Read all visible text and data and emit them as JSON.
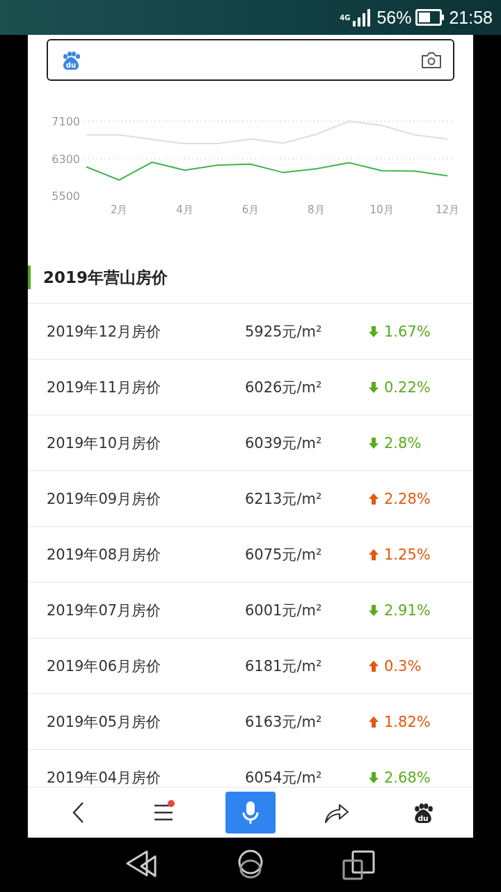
{
  "status_bar": {
    "network": "4G",
    "battery": "56%",
    "time": "21:58"
  },
  "search": {
    "logo_text": "du"
  },
  "chart": {
    "chart_data": {
      "type": "line",
      "x": [
        1,
        2,
        3,
        4,
        5,
        6,
        7,
        8,
        9,
        10,
        11,
        12
      ],
      "xlim": [
        1,
        12
      ],
      "xticks": [
        {
          "value": 2,
          "label": "2月"
        },
        {
          "value": 4,
          "label": "4月"
        },
        {
          "value": 6,
          "label": "6月"
        },
        {
          "value": 8,
          "label": "8月"
        },
        {
          "value": 10,
          "label": "10月"
        },
        {
          "value": 12,
          "label": "12月"
        }
      ],
      "ylim": [
        5500,
        7100
      ],
      "yticks": [
        5500,
        6300,
        7100
      ],
      "series": [
        {
          "color": "#dddddd",
          "values": [
            6810,
            6810,
            6710,
            6620,
            6620,
            6720,
            6630,
            6820,
            7100,
            7010,
            6810,
            6720
          ]
        },
        {
          "color": "#3cb44b",
          "values": [
            6120,
            5840,
            6220,
            6050,
            6160,
            6180,
            6000,
            6080,
            6210,
            6040,
            6030,
            5930
          ]
        }
      ]
    }
  },
  "section_title": "2019年营山房价",
  "rows": [
    {
      "month": "2019年12月房价",
      "price": "5925元/m²",
      "kind": "down",
      "change": "1.67%"
    },
    {
      "month": "2019年11月房价",
      "price": "6026元/m²",
      "kind": "down",
      "change": "0.22%"
    },
    {
      "month": "2019年10月房价",
      "price": "6039元/m²",
      "kind": "down",
      "change": "2.8%"
    },
    {
      "month": "2019年09月房价",
      "price": "6213元/m²",
      "kind": "up",
      "change": "2.28%"
    },
    {
      "month": "2019年08月房价",
      "price": "6075元/m²",
      "kind": "up",
      "change": "1.25%"
    },
    {
      "month": "2019年07月房价",
      "price": "6001元/m²",
      "kind": "down",
      "change": "2.91%"
    },
    {
      "month": "2019年06月房价",
      "price": "6181元/m²",
      "kind": "up",
      "change": "0.3%"
    },
    {
      "month": "2019年05月房价",
      "price": "6163元/m²",
      "kind": "up",
      "change": "1.82%"
    },
    {
      "month": "2019年04月房价",
      "price": "6054元/m²",
      "kind": "down",
      "change": "2.68%"
    }
  ],
  "bottom_nav": {
    "menu_badge": true,
    "logo_text": "du"
  }
}
